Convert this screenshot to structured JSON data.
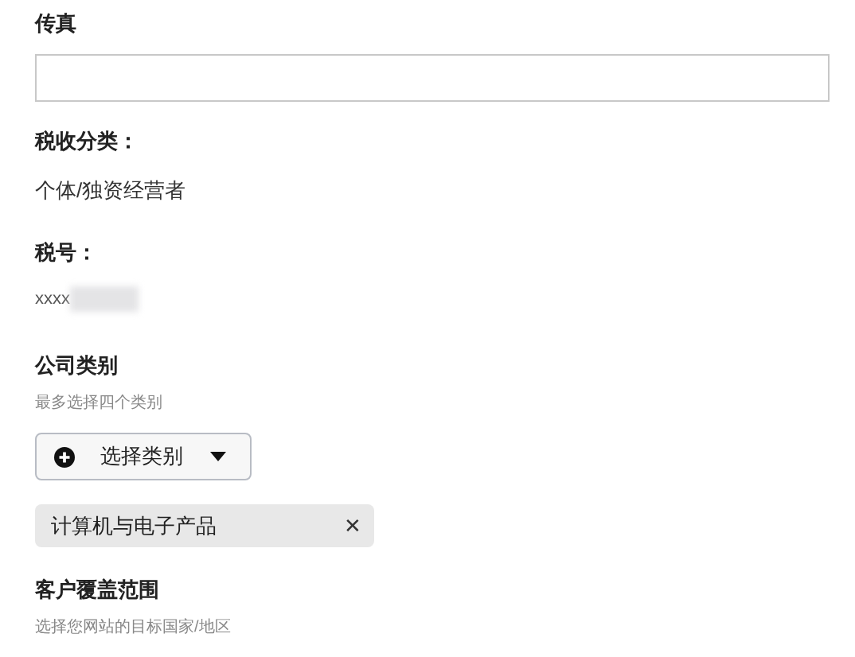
{
  "fax": {
    "label": "传真"
  },
  "tax_category": {
    "label": "税收分类：",
    "value": "个体/独资经营者"
  },
  "tax_number": {
    "label": "税号：",
    "value": "xxxx"
  },
  "company_category": {
    "label": "公司类别",
    "hint": "最多选择四个类别",
    "button": "选择类别",
    "tags": [
      {
        "label": "计算机与电子产品",
        "remove": "✕"
      }
    ]
  },
  "coverage": {
    "label": "客户覆盖范围",
    "hint": "选择您网站的目标国家/地区"
  }
}
